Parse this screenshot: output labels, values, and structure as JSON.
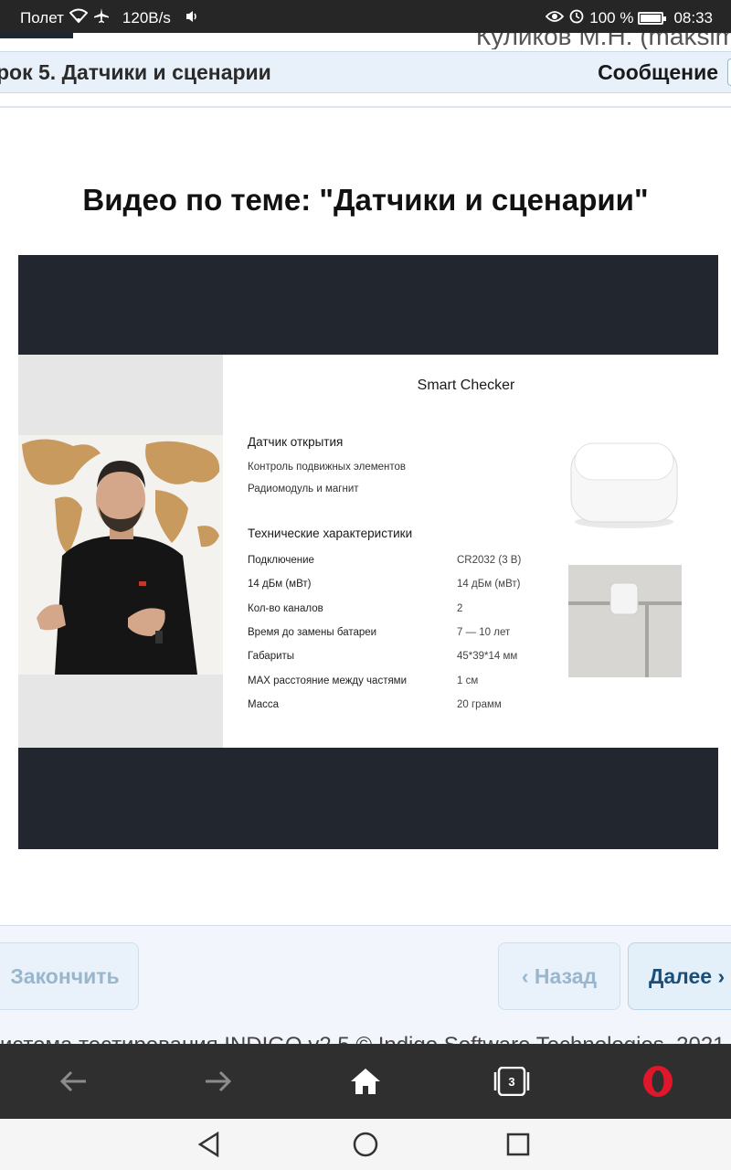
{
  "status_bar": {
    "carrier": "Полет",
    "speed": "120B/s",
    "battery": "100 %",
    "time": "08:33"
  },
  "header": {
    "user_name": "Куликов М.Н. (maksim",
    "lesson_title": "рок 5. Датчики и сценарии",
    "message_label": "Сообщение"
  },
  "content": {
    "video_title": "Видео по теме: \"Датчики и сценарии\""
  },
  "slide": {
    "title": "Smart Checker",
    "section1": {
      "heading": "Датчик открытия",
      "items": [
        "Контроль подвижных элементов",
        "Радиомодуль и магнит"
      ]
    },
    "section2": {
      "heading": "Технические характеристики",
      "rows": [
        {
          "label": "Подключение",
          "value": "CR2032 (3 В)"
        },
        {
          "label": "14 дБм (мВт)",
          "value": "14 дБм (мВт)"
        },
        {
          "label": "Кол-во каналов",
          "value": "2"
        },
        {
          "label": "Время до замены батареи",
          "value": "7 — 10 лет"
        },
        {
          "label": "Габариты",
          "value": "45*39*14 мм"
        },
        {
          "label": "MAX расстояние между частями",
          "value": "1 см"
        },
        {
          "label": "Масса",
          "value": "20 грамм"
        }
      ]
    }
  },
  "navigation": {
    "finish_label": "Закончить",
    "back_label": "‹ Назад",
    "next_label": "Далее ›"
  },
  "footer": {
    "text": "истема тестирования INDIGO v2.5 © Indigo Software Technologies, 2021"
  },
  "browser": {
    "tabs_count": "3"
  }
}
